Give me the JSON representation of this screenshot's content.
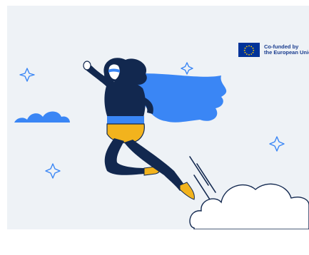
{
  "banner": {
    "background_color": "#eef2f6",
    "accent_blue": "#3a86f5",
    "navy": "#12284f",
    "yellow": "#f2b31d",
    "eu_logo": {
      "line1": "Co-funded by",
      "line2": "the European Union"
    },
    "illustration": "flying-superhero-woman"
  }
}
